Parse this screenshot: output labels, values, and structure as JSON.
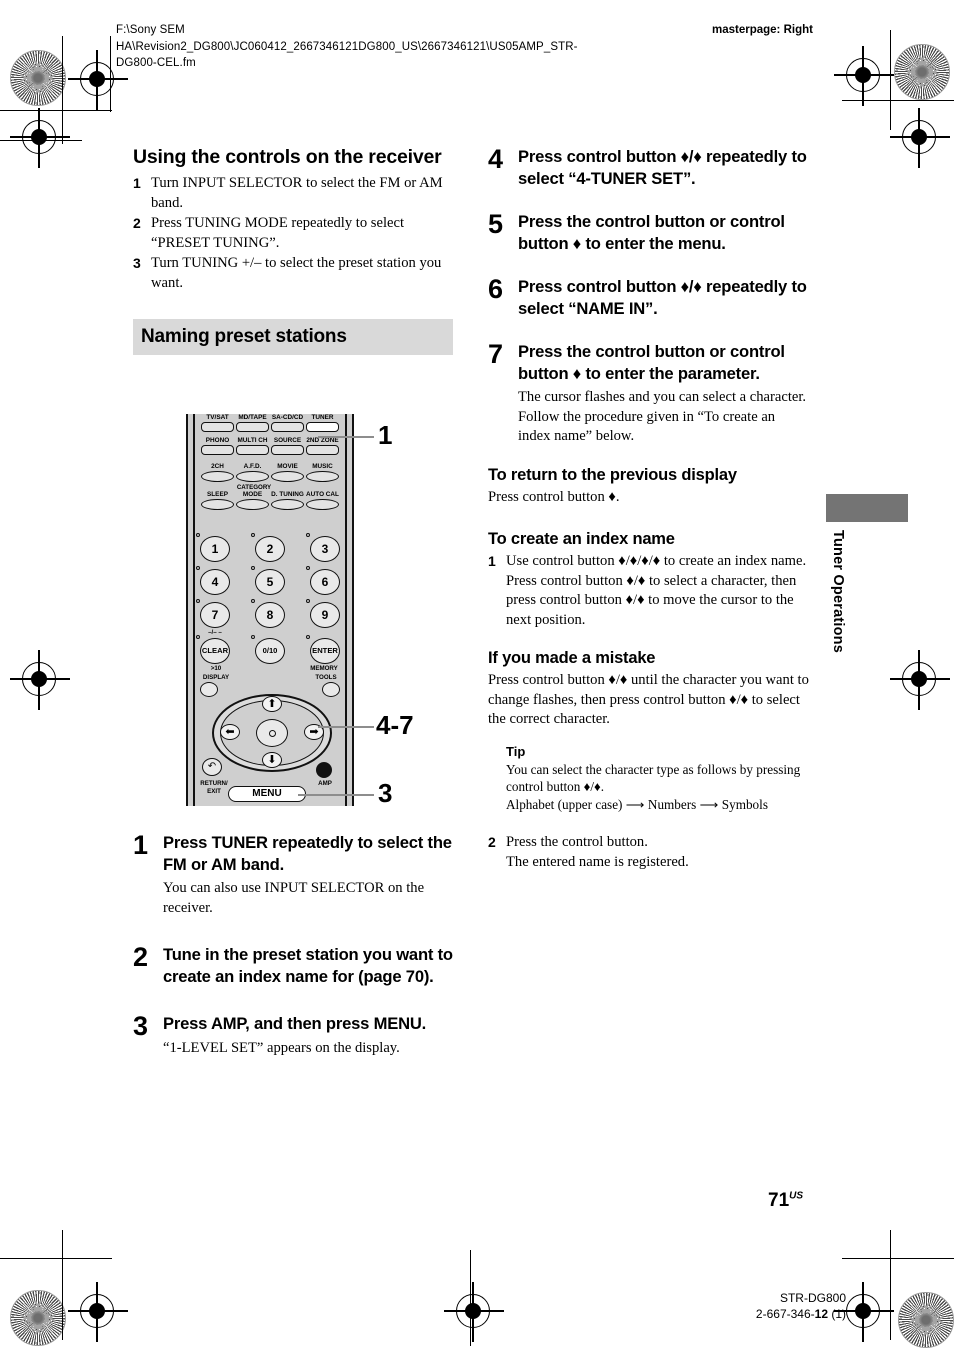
{
  "header": {
    "filepath": "F:\\Sony SEM HA\\Revision2_DG800\\JC060412_2667346121DG800_US\\2667346121\\US05AMP_STR-DG800-CEL.fm",
    "masterpage": "masterpage: Right"
  },
  "left": {
    "heading": "Using the controls on the receiver",
    "steps": [
      {
        "num": "1",
        "text": "Turn INPUT SELECTOR to select the FM or AM band."
      },
      {
        "num": "2",
        "text": "Press TUNING MODE repeatedly to select “PRESET TUNING”."
      },
      {
        "num": "3",
        "text": "Turn TUNING +/– to select the preset station you want."
      }
    ],
    "band_heading": "Naming preset stations",
    "big_steps": [
      {
        "num": "1",
        "head": "Press TUNER repeatedly to select the FM or AM band.",
        "note": "You can also use INPUT SELECTOR on the receiver."
      },
      {
        "num": "2",
        "head": "Tune in the preset station you want to create an index name for (page 70).",
        "note": ""
      },
      {
        "num": "3",
        "head": "Press AMP, and then press MENU.",
        "note": "“1-LEVEL SET” appears on the display."
      }
    ]
  },
  "remote": {
    "row1_labels": [
      "TV/SAT",
      "MD/TAPE",
      "SA-CD/CD",
      "TUNER"
    ],
    "row2_labels": [
      "PHONO",
      "MULTI CH",
      "SOURCE",
      "2ND ZONE"
    ],
    "row3_labels": [
      "2CH",
      "A.F.D.",
      "MOVIE",
      "MUSIC"
    ],
    "row4_labels": [
      "SLEEP",
      "MODE",
      "D. TUNING",
      "AUTO CAL"
    ],
    "category_label": "CATEGORY",
    "keys": [
      "1",
      "2",
      "3",
      "4",
      "5",
      "6",
      "7",
      "8",
      "9"
    ],
    "clear_label": "CLEAR",
    "clear_above": "–/– –",
    "clear_below": ">10",
    "zero_label": "0/10",
    "enter_label": "ENTER",
    "enter_below": "MEMORY",
    "display_label": "DISPLAY",
    "tools_label": "TOOLS",
    "return_label": "RETURN/",
    "exit_label": "EXIT",
    "menu_label": "MENU",
    "amp_label": "AMP",
    "arrow_up": "⬆",
    "arrow_down": "⬇",
    "arrow_left": "⬅",
    "arrow_right": "➡",
    "callouts": [
      "1",
      "4-7",
      "3"
    ]
  },
  "right": {
    "big_steps": [
      {
        "num": "4",
        "head": "Press control button ♦/♦ repeatedly to select “4-TUNER SET”.",
        "note": ""
      },
      {
        "num": "5",
        "head": "Press the control button or control button ♦ to enter the menu.",
        "note": ""
      },
      {
        "num": "6",
        "head": "Press control button ♦/♦ repeatedly to select “NAME IN”.",
        "note": ""
      },
      {
        "num": "7",
        "head": "Press the control button or control button ♦ to enter the parameter.",
        "note": "The cursor flashes and you can select a character. Follow the procedure given in “To create an index name” below."
      }
    ],
    "return_heading": "To return to the previous display",
    "return_body": "Press control button ♦.",
    "create_heading": "To create an index name",
    "create_step1_num": "1",
    "create_step1_line1": "Use control button ♦/♦/♦/♦ to create an index name.",
    "create_step1_line2": "Press control button ♦/♦ to select a character, then press control button ♦/♦ to move the cursor to the next position.",
    "mistake_heading": "If you made a mistake",
    "mistake_body": "Press control button ♦/♦ until the character you want to change flashes, then press control button ♦/♦ to select the correct character.",
    "tip_heading": "Tip",
    "tip_line1": "You can select the character type as follows by pressing control button ♦/♦.",
    "tip_line2": "Alphabet (upper case) ⟶ Numbers ⟶ Symbols",
    "create_step2_num": "2",
    "create_step2_line1": "Press the control button.",
    "create_step2_line2": "The entered name is registered."
  },
  "side_tab": {
    "label": "Tuner Operations",
    "color": "#747474"
  },
  "footer": {
    "page_number": "71",
    "page_suffix": "US",
    "model": "STR-DG800",
    "part_prefix": "2-667-346-",
    "part_bold": "12",
    "part_suffix": " (1)"
  }
}
